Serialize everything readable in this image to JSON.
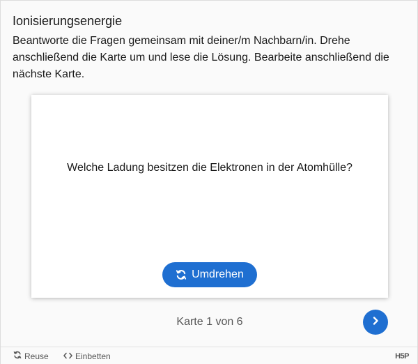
{
  "header": {
    "title": "Ionisierungsenergie",
    "description": "Beantworte die Fragen gemeinsam mit deiner/m Nachbarn/in. Drehe anschließend die Karte um und lese die Lösung. Bearbeite anschließend die nächste Karte."
  },
  "card": {
    "question": "Welche Ladung besitzen die Elektronen in der Atomhülle?",
    "turn_label": "Umdrehen",
    "turn_icon": "refresh-icon"
  },
  "navigation": {
    "progress": "Karte 1 von 6",
    "next_icon": "chevron-right-icon"
  },
  "footer": {
    "reuse_label": "Reuse",
    "embed_label": "Einbetten",
    "logo": "H5P"
  },
  "colors": {
    "accent": "#1f6fd1",
    "background": "#fafafa",
    "card": "#ffffff"
  }
}
